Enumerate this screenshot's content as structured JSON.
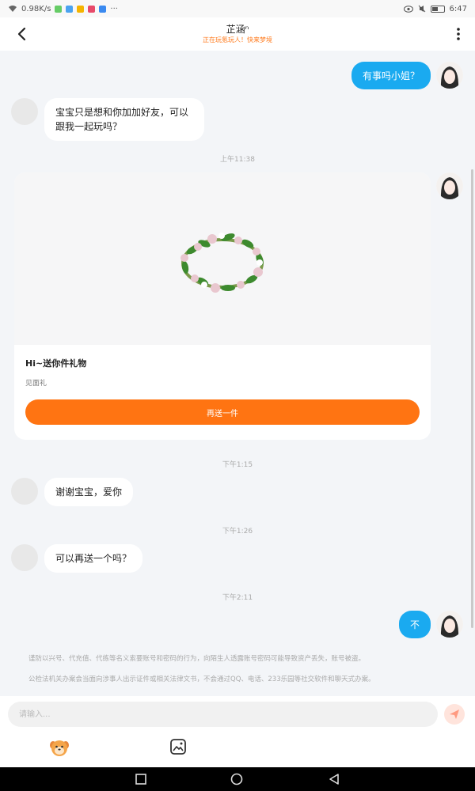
{
  "status": {
    "speed": "0.98K/s",
    "time": "6:47"
  },
  "header": {
    "title": "芷涵ⁿ",
    "subtitle": "正在玩氪玩人！快来梦境"
  },
  "messages": {
    "m1": "有事吗小姐？",
    "m2": "宝宝只是想和你加加好友，可以跟我一起玩吗？",
    "t1": "上午11:38",
    "gift_title": "Hi~送你件礼物",
    "gift_sub": "见面礼",
    "gift_button": "再送一件",
    "t2": "下午1:15",
    "m3": "谢谢宝宝，爱你",
    "t3": "下午1:26",
    "m4": "可以再送一个吗？",
    "t4": "下午2:11",
    "m5": "不"
  },
  "warning": {
    "line1": "谨防以兴号、代充值、代练等名义索要账号和密码的行为，向陌生人透露账号密码可能导致资产丢失，账号被盗。",
    "line2": "公检法机关办案会当面向涉事人出示证件或相关法律文书，不会通过QQ、电话、233乐园等社交软件和聊天式办案。"
  },
  "input": {
    "placeholder": "请输入..."
  },
  "colors": {
    "accent_blue": "#1aaaf0",
    "accent_orange": "#ff7412"
  },
  "icons": [
    "back-arrow-icon",
    "more-vertical-icon",
    "send-icon",
    "emoji-face-icon",
    "image-icon",
    "square-nav-icon",
    "home-nav-icon",
    "back-nav-icon"
  ]
}
